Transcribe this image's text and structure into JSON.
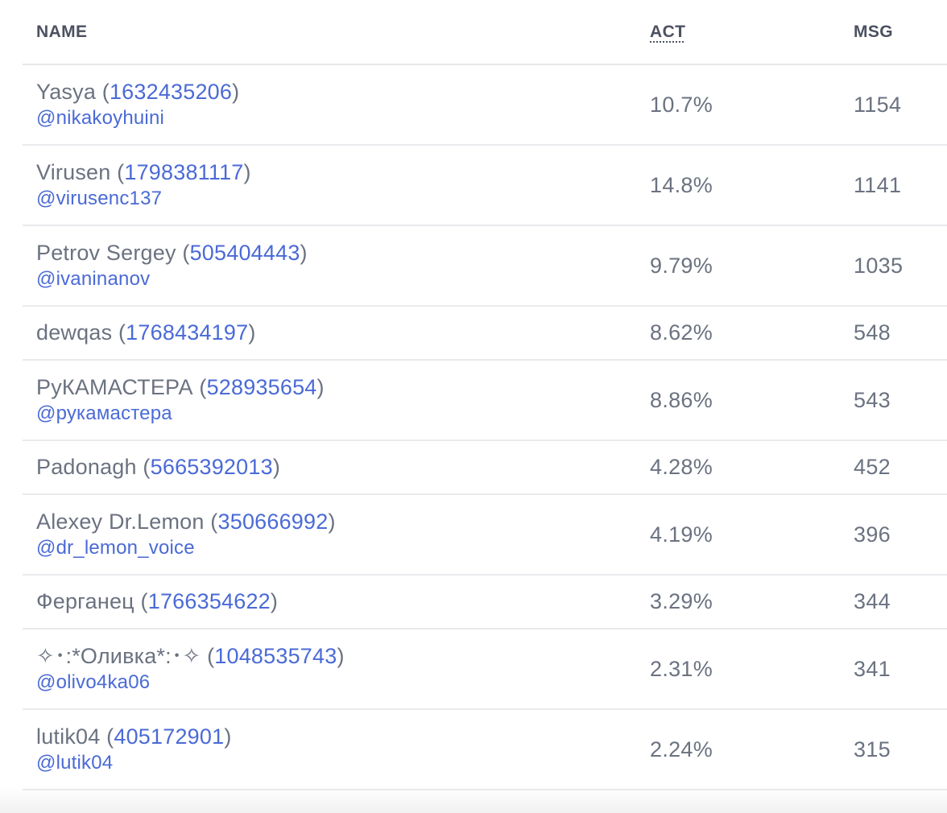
{
  "table": {
    "headers": {
      "name": "NAME",
      "act": "ACT",
      "msg": "MSG"
    },
    "rows": [
      {
        "name": "Yasya",
        "id": "1632435206",
        "username": "@nikakoyhuini",
        "act": "10.7%",
        "msg": "1154"
      },
      {
        "name": "Virusen",
        "id": "1798381117",
        "username": "@virusenc137",
        "act": "14.8%",
        "msg": "1141"
      },
      {
        "name": "Petrov Sergey",
        "id": "505404443",
        "username": "@ivaninanov",
        "act": "9.79%",
        "msg": "1035"
      },
      {
        "name": "dewqas",
        "id": "1768434197",
        "username": null,
        "act": "8.62%",
        "msg": "548"
      },
      {
        "name": "РуКАМАСТЕРА",
        "id": "528935654",
        "username": "@рукамастера",
        "act": "8.86%",
        "msg": "543"
      },
      {
        "name": "Padonagh",
        "id": "5665392013",
        "username": null,
        "act": "4.28%",
        "msg": "452"
      },
      {
        "name": "Alexey Dr.Lemon",
        "id": "350666992",
        "username": "@dr_lemon_voice",
        "act": "4.19%",
        "msg": "396"
      },
      {
        "name": "Ферганец",
        "id": "1766354622",
        "username": null,
        "act": "3.29%",
        "msg": "344"
      },
      {
        "name": "✧･:*Оливка*:･✧",
        "id": "1048535743",
        "username": "@olivo4ka06",
        "act": "2.31%",
        "msg": "341"
      },
      {
        "name": "lutik04",
        "id": "405172901",
        "username": "@lutik04",
        "act": "2.24%",
        "msg": "315"
      }
    ]
  },
  "colors": {
    "text": "#6b7280",
    "header_text": "#4b5160",
    "link": "#4a6ad6",
    "divider": "#e9eaed"
  }
}
